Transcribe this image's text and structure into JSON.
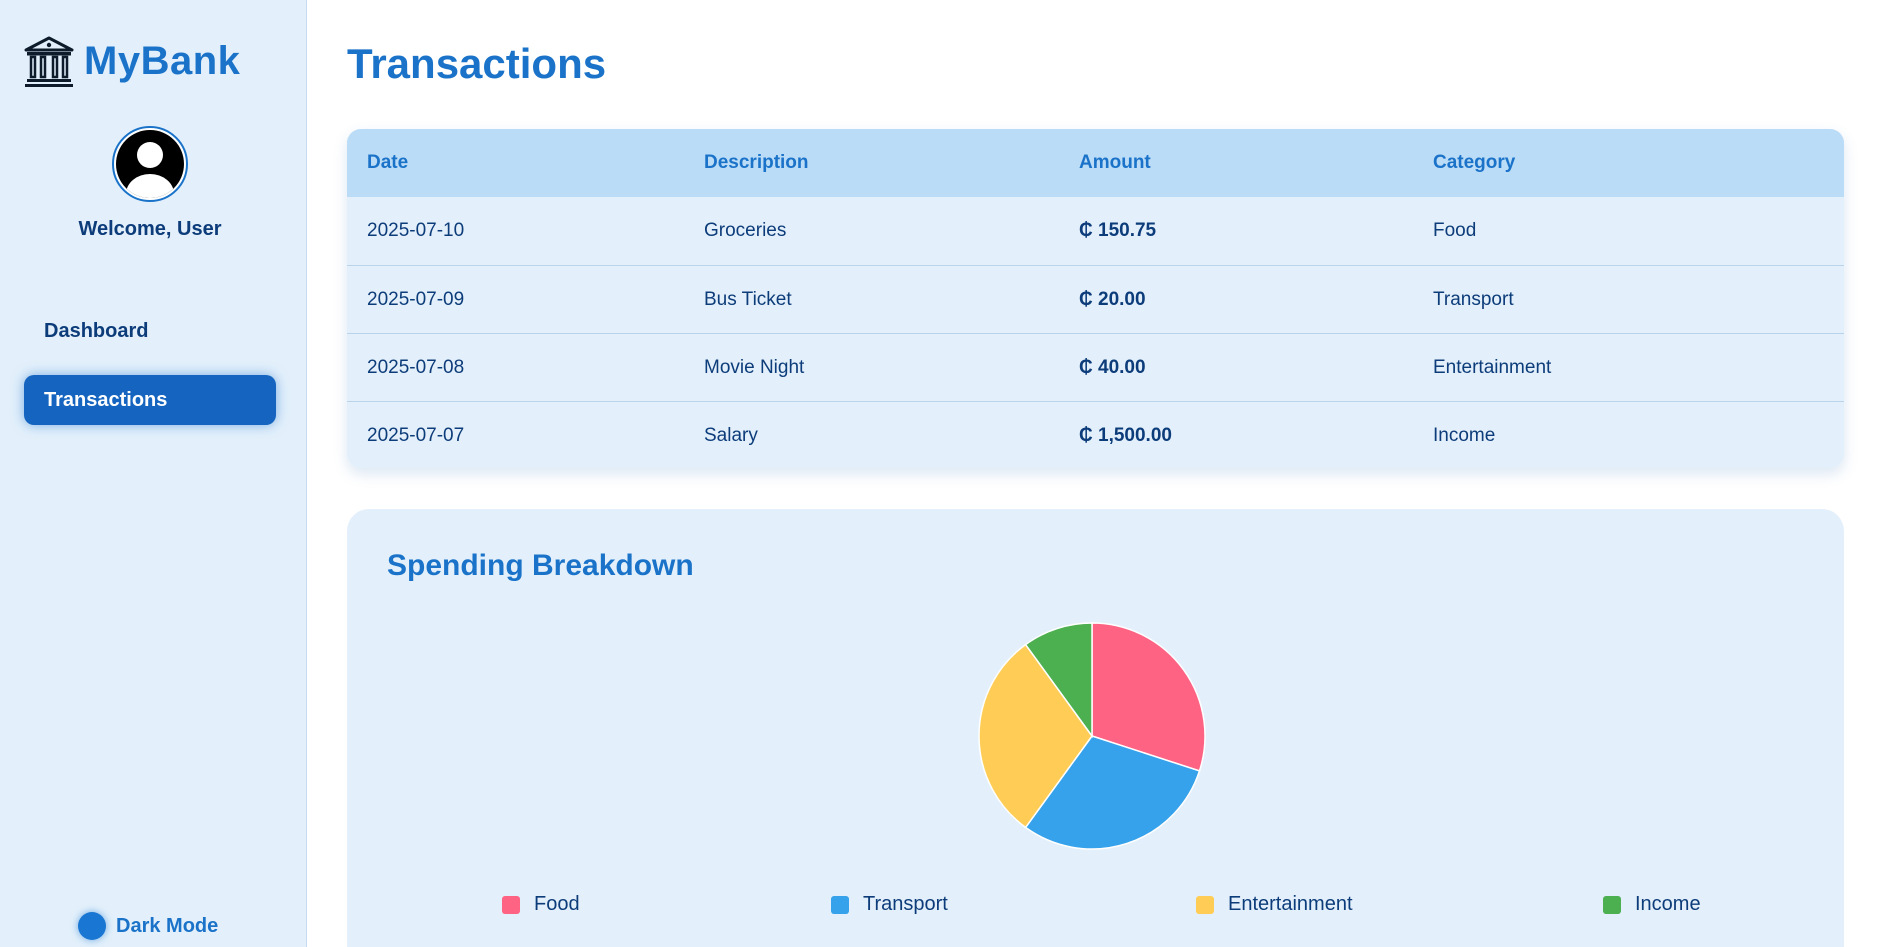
{
  "sidebar": {
    "brand": "MyBank",
    "welcome": "Welcome, User",
    "nav": [
      {
        "label": "Dashboard",
        "active": false
      },
      {
        "label": "Transactions",
        "active": true
      }
    ],
    "dark_mode_label": "Dark Mode",
    "icons": {
      "logo": "bank-icon",
      "avatar": "user-avatar-icon"
    }
  },
  "main": {
    "title": "Transactions",
    "table": {
      "headers": [
        "Date",
        "Description",
        "Amount",
        "Category"
      ],
      "rows": [
        [
          "2025-07-10",
          "Groceries",
          "₵ 150.75",
          "Food"
        ],
        [
          "2025-07-09",
          "Bus Ticket",
          "₵ 20.00",
          "Transport"
        ],
        [
          "2025-07-08",
          "Movie Night",
          "₵ 40.00",
          "Entertainment"
        ],
        [
          "2025-07-07",
          "Salary",
          "₵ 1,500.00",
          "Income"
        ]
      ]
    },
    "chart_title": "Spending Breakdown"
  },
  "colors": {
    "accent": "#1a73c9",
    "active_nav": "#1565c0",
    "food": "#ff6384",
    "transport": "#36a2eb",
    "entertainment": "#ffcd56",
    "income": "#4caf50"
  },
  "chart_data": {
    "type": "pie",
    "title": "Spending Breakdown",
    "categories": [
      "Food",
      "Transport",
      "Entertainment",
      "Income"
    ],
    "values": [
      30,
      30,
      30,
      10
    ],
    "legend_position": "bottom"
  }
}
